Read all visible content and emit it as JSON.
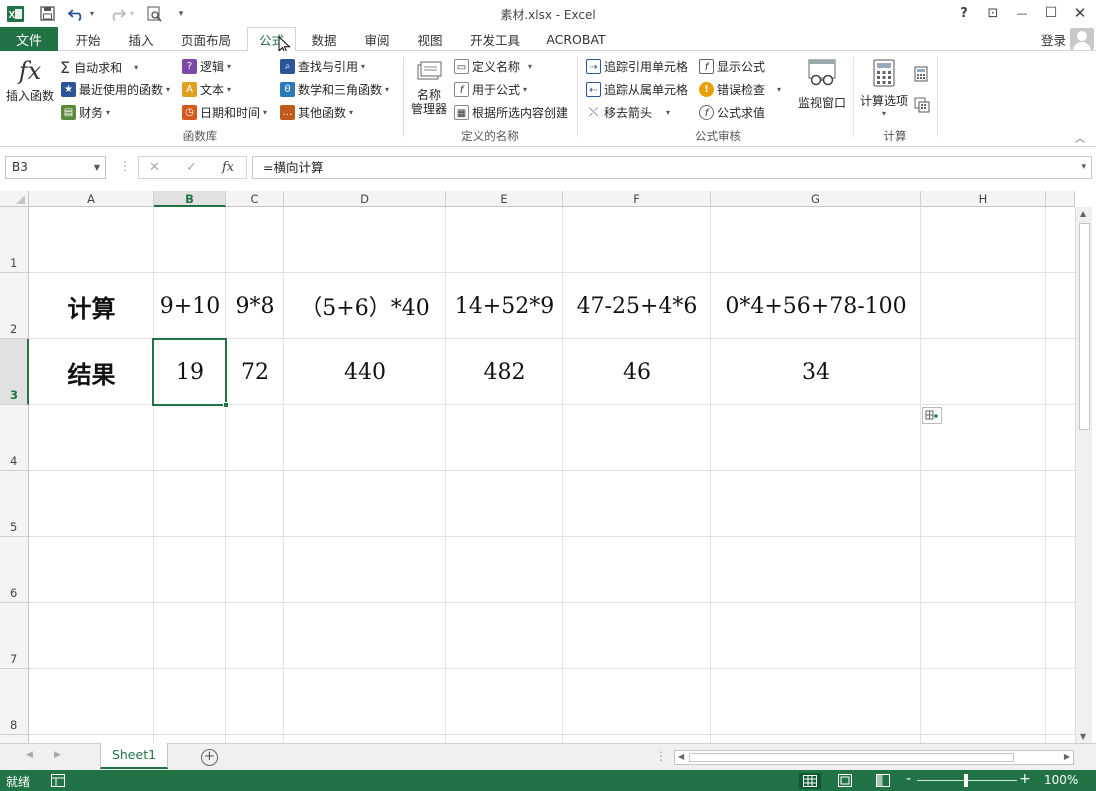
{
  "window": {
    "title": "素材.xlsx - Excel"
  },
  "quick_access": {
    "app_icon": "excel-icon",
    "save_icon": "save-icon",
    "undo_icon": "undo-icon",
    "redo_icon": "redo-icon",
    "preview_icon": "print-preview-icon",
    "customize": "▾"
  },
  "window_controls": {
    "help": "?",
    "ribbon_display": "⊡",
    "minimize": "—",
    "maximize": "☐",
    "close": "✕"
  },
  "tabs": {
    "file": "文件",
    "items": [
      {
        "label": "开始"
      },
      {
        "label": "插入"
      },
      {
        "label": "页面布局"
      },
      {
        "label": "公式"
      },
      {
        "label": "数据"
      },
      {
        "label": "审阅"
      },
      {
        "label": "视图"
      },
      {
        "label": "开发工具"
      },
      {
        "label": "ACROBAT"
      }
    ],
    "active": "公式",
    "login": "登录"
  },
  "ribbon": {
    "function_library": {
      "insert_function": "插入函数",
      "autosum": "自动求和",
      "recent": "最近使用的函数",
      "financial": "财务",
      "logical": "逻辑",
      "text": "文本",
      "datetime": "日期和时间",
      "lookup": "查找与引用",
      "math": "数学和三角函数",
      "more": "其他函数",
      "group_label": "函数库"
    },
    "defined_names": {
      "name_manager_1": "名称",
      "name_manager_2": "管理器",
      "define_name": "定义名称",
      "use_in_formula": "用于公式",
      "create_from_selection": "根据所选内容创建",
      "group_label": "定义的名称"
    },
    "formula_auditing": {
      "trace_precedents": "追踪引用单元格",
      "trace_dependents": "追踪从属单元格",
      "remove_arrows": "移去箭头",
      "show_formulas": "显示公式",
      "error_checking": "错误检查",
      "evaluate_formula": "公式求值",
      "watch_window": "监视窗口",
      "group_label": "公式审核"
    },
    "calculation": {
      "options": "计算选项",
      "group_label": "计算"
    }
  },
  "formula_bar": {
    "name_box": "B3",
    "cancel": "✕",
    "enter": "✓",
    "fx": "fx",
    "formula": "=横向计算"
  },
  "grid": {
    "columns": [
      "A",
      "B",
      "C",
      "D",
      "E",
      "F",
      "G",
      "H"
    ],
    "selected_column": "B",
    "rows": [
      "1",
      "2",
      "3",
      "4",
      "5",
      "6",
      "7",
      "8"
    ],
    "selected_row": "3",
    "row2": {
      "label": "计算",
      "values": [
        "9+10",
        "9*8",
        "（5+6）*40",
        "14+52*9",
        "47-25+4*6",
        "0*4+56+78-100"
      ]
    },
    "row3": {
      "label": "结果",
      "values": [
        "19",
        "72",
        "440",
        "482",
        "46",
        "34"
      ]
    }
  },
  "sheets": {
    "items": [
      "Sheet1"
    ],
    "active": "Sheet1",
    "add": "+"
  },
  "status": {
    "mode": "就绪",
    "zoom": "100%",
    "zoom_minus": "-",
    "zoom_plus": "+"
  },
  "colors": {
    "accent": "#217346"
  }
}
